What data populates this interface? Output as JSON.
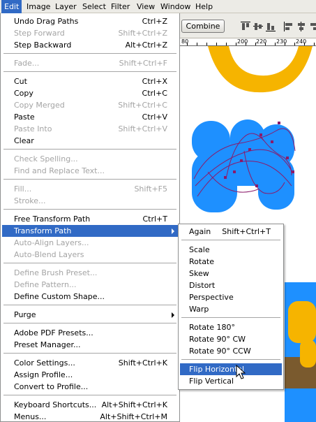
{
  "menubar": {
    "items": [
      {
        "label": "Edit"
      },
      {
        "label": "Image"
      },
      {
        "label": "Layer"
      },
      {
        "label": "Select"
      },
      {
        "label": "Filter"
      },
      {
        "label": "View"
      },
      {
        "label": "Window"
      },
      {
        "label": "Help"
      }
    ]
  },
  "options": {
    "combine_label": "Combine",
    "align_icons": [
      "align-top-edges-icon",
      "align-vertical-centers-icon",
      "align-bottom-edges-icon",
      "align-left-edges-icon",
      "align-horizontal-centers-icon",
      "align-right-edges-icon"
    ]
  },
  "ruler": {
    "labels": [
      "80",
      "200",
      "220",
      "230",
      "240"
    ]
  },
  "edit_menu": {
    "items": [
      {
        "label": "Undo Drag Paths",
        "shortcut": "Ctrl+Z"
      },
      {
        "label": "Step Forward",
        "shortcut": "Shift+Ctrl+Z",
        "disabled": true
      },
      {
        "label": "Step Backward",
        "shortcut": "Alt+Ctrl+Z"
      },
      {
        "label": "Fade...",
        "shortcut": "Shift+Ctrl+F",
        "disabled": true
      },
      {
        "label": "Cut",
        "shortcut": "Ctrl+X"
      },
      {
        "label": "Copy",
        "shortcut": "Ctrl+C"
      },
      {
        "label": "Copy Merged",
        "shortcut": "Shift+Ctrl+C",
        "disabled": true
      },
      {
        "label": "Paste",
        "shortcut": "Ctrl+V"
      },
      {
        "label": "Paste Into",
        "shortcut": "Shift+Ctrl+V",
        "disabled": true
      },
      {
        "label": "Clear",
        "shortcut": ""
      },
      {
        "label": "Check Spelling...",
        "shortcut": "",
        "disabled": true
      },
      {
        "label": "Find and Replace Text...",
        "shortcut": "",
        "disabled": true
      },
      {
        "label": "Fill...",
        "shortcut": "Shift+F5",
        "disabled": true
      },
      {
        "label": "Stroke...",
        "shortcut": "",
        "disabled": true
      },
      {
        "label": "Free Transform Path",
        "shortcut": "Ctrl+T"
      },
      {
        "label": "Transform Path",
        "shortcut": "",
        "submenu": true,
        "selected": true
      },
      {
        "label": "Auto-Align Layers...",
        "shortcut": "",
        "disabled": true
      },
      {
        "label": "Auto-Blend Layers",
        "shortcut": "",
        "disabled": true
      },
      {
        "label": "Define Brush Preset...",
        "shortcut": "",
        "disabled": true
      },
      {
        "label": "Define Pattern...",
        "shortcut": "",
        "disabled": true
      },
      {
        "label": "Define Custom Shape...",
        "shortcut": ""
      },
      {
        "label": "Purge",
        "shortcut": "",
        "submenu": true
      },
      {
        "label": "Adobe PDF Presets...",
        "shortcut": ""
      },
      {
        "label": "Preset Manager...",
        "shortcut": ""
      },
      {
        "label": "Color Settings...",
        "shortcut": "Shift+Ctrl+K"
      },
      {
        "label": "Assign Profile...",
        "shortcut": ""
      },
      {
        "label": "Convert to Profile...",
        "shortcut": ""
      },
      {
        "label": "Keyboard Shortcuts...",
        "shortcut": "Alt+Shift+Ctrl+K"
      },
      {
        "label": "Menus...",
        "shortcut": "Alt+Shift+Ctrl+M"
      }
    ]
  },
  "submenu": {
    "items": [
      {
        "label": "Again",
        "shortcut": "Shift+Ctrl+T"
      },
      {
        "label": "Scale",
        "shortcut": ""
      },
      {
        "label": "Rotate",
        "shortcut": ""
      },
      {
        "label": "Skew",
        "shortcut": ""
      },
      {
        "label": "Distort",
        "shortcut": ""
      },
      {
        "label": "Perspective",
        "shortcut": ""
      },
      {
        "label": "Warp",
        "shortcut": ""
      },
      {
        "label": "Rotate 180°",
        "shortcut": ""
      },
      {
        "label": "Rotate 90° CW",
        "shortcut": ""
      },
      {
        "label": "Rotate 90° CCW",
        "shortcut": ""
      },
      {
        "label": "Flip Horizontal",
        "shortcut": "",
        "selected": true
      },
      {
        "label": "Flip Vertical",
        "shortcut": ""
      }
    ]
  },
  "colors": {
    "menu_highlight": "#316ac5",
    "shape_blue": "#1e90ff",
    "shape_yellow": "#f6b400",
    "shape_brown": "#7a5a2e",
    "path_purple": "#8b1a6b"
  }
}
